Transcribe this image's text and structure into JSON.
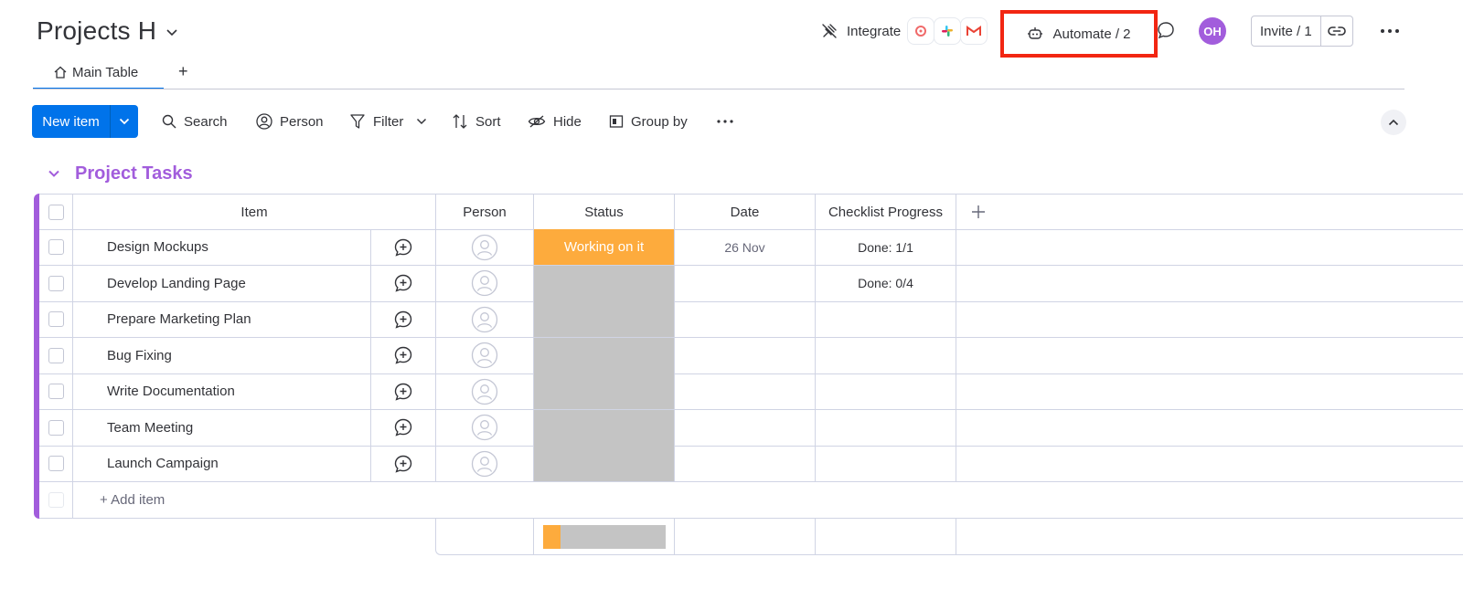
{
  "board": {
    "title": "Projects H"
  },
  "tabs": {
    "main_label": "Main Table",
    "add_label": "+"
  },
  "header": {
    "integrate_label": "Integrate",
    "integration_apps": [
      "asana-icon",
      "slack-icon",
      "gmail-icon"
    ],
    "automate_label": "Automate / 2",
    "avatar_initials": "OH",
    "invite_label": "Invite / 1"
  },
  "toolbar": {
    "new_item_label": "New item",
    "search_label": "Search",
    "person_label": "Person",
    "filter_label": "Filter",
    "sort_label": "Sort",
    "hide_label": "Hide",
    "group_by_label": "Group by"
  },
  "group": {
    "title": "Project Tasks",
    "color": "#a25ddc",
    "columns": {
      "item": "Item",
      "person": "Person",
      "status": "Status",
      "date": "Date",
      "checklist": "Checklist Progress"
    },
    "rows": [
      {
        "name": "Design Mockups",
        "status": "Working on it",
        "status_color": "#fdab3d",
        "date": "26 Nov",
        "checklist": "Done: 1/1"
      },
      {
        "name": "Develop Landing Page",
        "status": "",
        "status_color": "#c4c4c4",
        "date": "",
        "checklist": "Done: 0/4"
      },
      {
        "name": "Prepare Marketing Plan",
        "status": "",
        "status_color": "#c4c4c4",
        "date": "",
        "checklist": ""
      },
      {
        "name": "Bug Fixing",
        "status": "",
        "status_color": "#c4c4c4",
        "date": "",
        "checklist": ""
      },
      {
        "name": "Write Documentation",
        "status": "",
        "status_color": "#c4c4c4",
        "date": "",
        "checklist": ""
      },
      {
        "name": "Team Meeting",
        "status": "",
        "status_color": "#c4c4c4",
        "date": "",
        "checklist": ""
      },
      {
        "name": "Launch Campaign",
        "status": "",
        "status_color": "#c4c4c4",
        "date": "",
        "checklist": ""
      }
    ],
    "add_item_label": "+ Add item",
    "status_summary": [
      {
        "label": "Working on it",
        "color": "#fdab3d",
        "fraction": 0.143
      },
      {
        "label": "",
        "color": "#c4c4c4",
        "fraction": 0.857
      }
    ]
  },
  "colors": {
    "accent": "#0073ea",
    "highlight_box": "#f22612"
  }
}
